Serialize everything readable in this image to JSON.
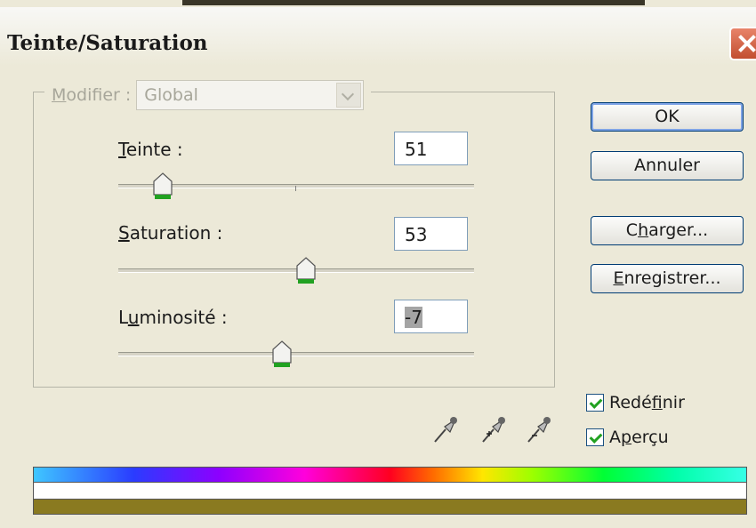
{
  "window": {
    "title": "Teinte/Saturation"
  },
  "edit": {
    "label_prefix": "M",
    "label_rest": "odifier :",
    "value": "Global"
  },
  "hue": {
    "label_u": "T",
    "label_rest": "einte :",
    "value": "51"
  },
  "saturation": {
    "label_u": "S",
    "label_rest": "aturation :",
    "value": "53"
  },
  "lightness": {
    "label_pre": "L",
    "label_u": "u",
    "label_rest": "minosité :",
    "value": "-7"
  },
  "buttons": {
    "ok": "OK",
    "cancel": "Annuler",
    "load_pre": "C",
    "load_u": "h",
    "load_rest": "arger...",
    "save_u": "E",
    "save_rest": "nregistrer..."
  },
  "checkboxes": {
    "colorize_pre": "Redé",
    "colorize_u": "f",
    "colorize_rest": "inir",
    "colorize_checked": true,
    "preview_pre": "A",
    "preview_u": "p",
    "preview_rest": "erçu",
    "preview_checked": true
  },
  "icons": [
    "eyedropper-icon",
    "eyedropper-plus-icon",
    "eyedropper-minus-icon",
    "close-icon"
  ]
}
